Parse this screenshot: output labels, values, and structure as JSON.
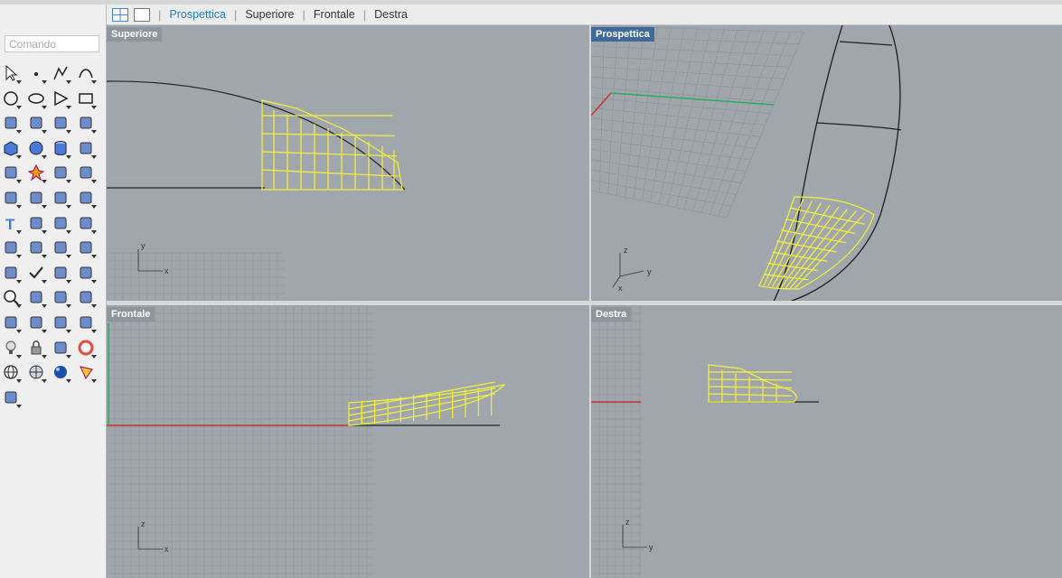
{
  "command": {
    "placeholder": "Comando"
  },
  "tabs": [
    {
      "label": "Prospettica",
      "active": true
    },
    {
      "label": "Superiore",
      "active": false
    },
    {
      "label": "Frontale",
      "active": false
    },
    {
      "label": "Destra",
      "active": false
    }
  ],
  "viewports": {
    "top_left": {
      "label": "Superiore"
    },
    "top_right": {
      "label": "Prospettica"
    },
    "bottom_left": {
      "label": "Frontale"
    },
    "bottom_right": {
      "label": "Destra"
    }
  },
  "axes": {
    "superiore": [
      "y",
      "x"
    ],
    "prospettica": [
      "z",
      "y",
      "x"
    ],
    "frontale": [
      "z",
      "x"
    ],
    "destra": [
      "z",
      "y"
    ]
  },
  "colors": {
    "accent": "#1f7fcf",
    "viewport_bg": "#a1a6ad",
    "active_label_bg": "#3d6a98",
    "inactive_label_bg": "#8f959d",
    "surface_wire": "#f2f23a",
    "x_axis": "#c0392b",
    "y_axis": "#27ae60"
  },
  "toolbar_icons": [
    "select-arrow-icon",
    "point-icon",
    "polyline-icon",
    "curve-points-icon",
    "circle-icon",
    "ellipse-icon",
    "polygon-icon",
    "rectangle-icon",
    "fillet-curve-icon",
    "offset-curve-icon",
    "surface-from-curves-icon",
    "patch-surface-icon",
    "box-solid-icon",
    "sphere-solid-icon",
    "cylinder-solid-icon",
    "extrude-surface-icon",
    "boolean-union-icon",
    "explode-icon",
    "extend-surface-icon",
    "trim-icon",
    "join-icon",
    "group-icon",
    "curve-fillet-icon",
    "blend-curve-icon",
    "text-icon",
    "transform-scale-icon",
    "array-icon",
    "mirror-icon",
    "solid-edit-icon",
    "dimension-icon",
    "grid-array-icon",
    "layer-tools-icon",
    "analyze-icon",
    "check-icon",
    "shell-icon",
    "render-cone-icon",
    "zoom-icon",
    "zoom-window-icon",
    "zoom-extents-icon",
    "zoom-selected-icon",
    "rotate-view-icon",
    "car-render-icon",
    "cplane-icon",
    "grid-snap-icon",
    "light-bulb-icon",
    "lock-icon",
    "material-icon",
    "color-wheel-icon",
    "wire-sphere-icon",
    "shaded-sphere-icon",
    "render-sphere-icon",
    "pen-tool-icon",
    "hierarchy-icon"
  ]
}
